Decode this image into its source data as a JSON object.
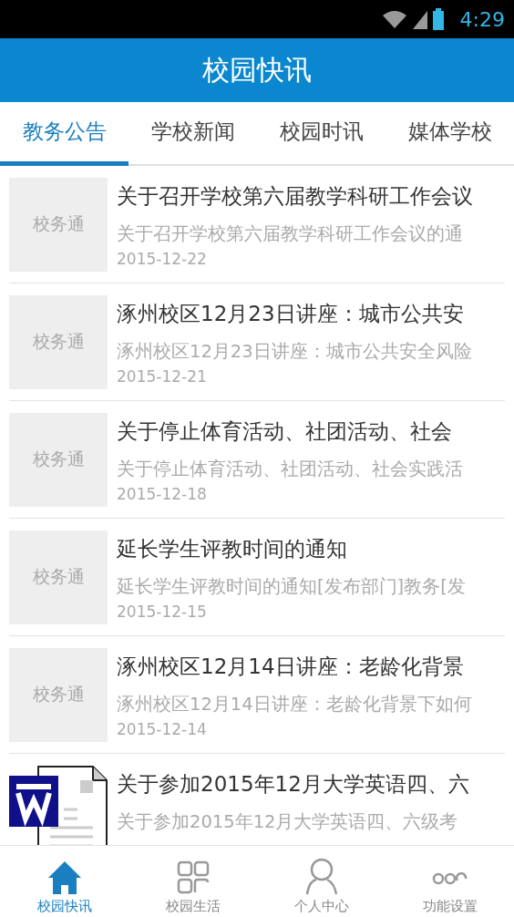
{
  "status_bar": {
    "time": "4:29"
  },
  "header": {
    "title": "校园快讯"
  },
  "tabs": [
    {
      "label": "教务公告",
      "selected": true
    },
    {
      "label": "学校新闻",
      "selected": false
    },
    {
      "label": "校园时讯",
      "selected": false
    },
    {
      "label": "媒体学校",
      "selected": false
    }
  ],
  "news": [
    {
      "thumb": {
        "kind": "placeholder",
        "text": "校务通"
      },
      "title": "关于召开学校第六届教学科研工作会议",
      "summary": "关于召开学校第六届教学科研工作会议的通",
      "date": "2015-12-22"
    },
    {
      "thumb": {
        "kind": "placeholder",
        "text": "校务通"
      },
      "title": "涿州校区12月23日讲座：城市公共安",
      "summary": "涿州校区12月23日讲座：城市公共安全风险",
      "date": "2015-12-21"
    },
    {
      "thumb": {
        "kind": "placeholder",
        "text": "校务通"
      },
      "title": "关于停止体育活动、社团活动、社会",
      "summary": "关于停止体育活动、社团活动、社会实践活",
      "date": "2015-12-18"
    },
    {
      "thumb": {
        "kind": "placeholder",
        "text": "校务通"
      },
      "title": "延长学生评教时间的通知",
      "summary": "延长学生评教时间的通知[发布部门]教务[发",
      "date": "2015-12-15"
    },
    {
      "thumb": {
        "kind": "placeholder",
        "text": "校务通"
      },
      "title": "涿州校区12月14日讲座：老龄化背景",
      "summary": "涿州校区12月14日讲座：老龄化背景下如何",
      "date": "2015-12-14"
    },
    {
      "thumb": {
        "kind": "document"
      },
      "title": "关于参加2015年12月大学英语四、六",
      "summary": "关于参加2015年12月大学英语四、六级考"
    }
  ],
  "bottom_nav": [
    {
      "label": "校园快讯",
      "selected": true
    },
    {
      "label": "校园生活",
      "selected": false
    },
    {
      "label": "个人中心",
      "selected": false
    },
    {
      "label": "功能设置",
      "selected": false
    }
  ]
}
